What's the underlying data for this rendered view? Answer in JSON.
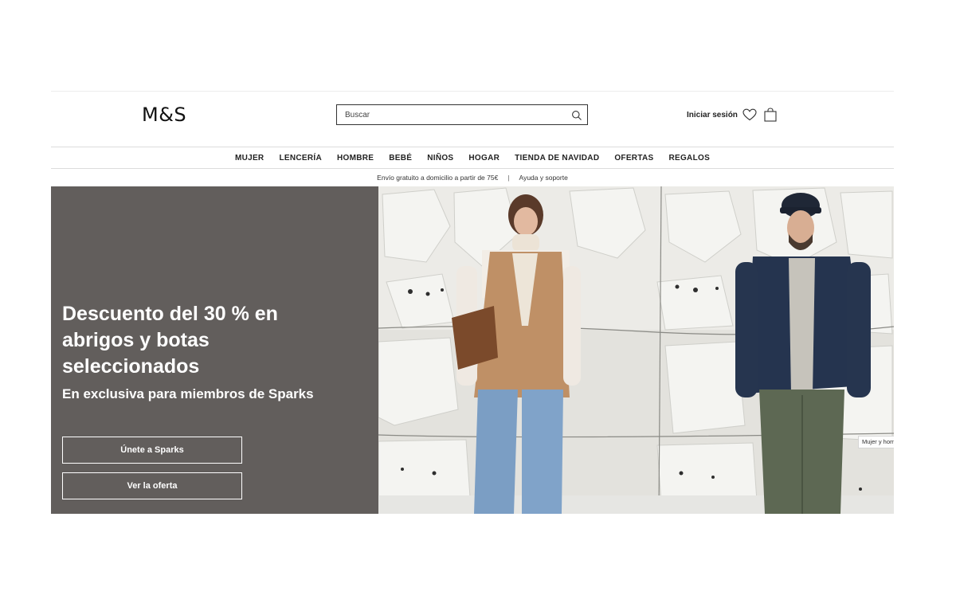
{
  "header": {
    "logo": "M&S",
    "search_placeholder": "Buscar",
    "sign_in_label": "Iniciar sesión",
    "icons": [
      "search-icon",
      "heart-icon",
      "bag-icon"
    ]
  },
  "nav": {
    "items": [
      "MUJER",
      "LENCERÍA",
      "HOMBRE",
      "BEBÉ",
      "NIÑOS",
      "HOGAR",
      "TIENDA DE NAVIDAD",
      "OFERTAS",
      "REGALOS"
    ]
  },
  "utility": {
    "shipping": "Envío gratuito a domicilio a partir de 75€",
    "separator": "|",
    "help": "Ayuda y soporte"
  },
  "hero": {
    "title": "Descuento del 30 % en abrigos y botas seleccionados",
    "subtitle": "En exclusiva para miembros de Sparks",
    "join_button": "Únete a Sparks",
    "offer_button": "Ver la oferta",
    "image_tag": "Mujer y hom",
    "panel_color": "#625e5c"
  }
}
